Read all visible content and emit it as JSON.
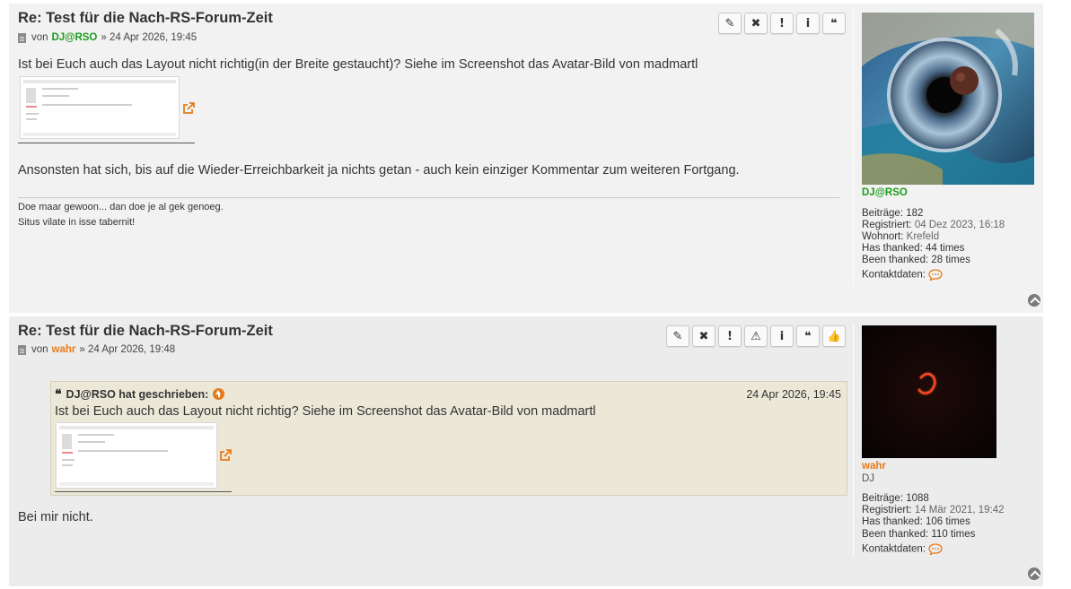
{
  "colors": {
    "accent_orange": "#e57c1c",
    "author_green": "#1e9b1e",
    "post1_bg": "#f2f2f2",
    "post2_bg": "#ececec",
    "quote_bg": "#ebe8d8"
  },
  "posts": [
    {
      "title": "Re: Test für die Nach-RS-Forum-Zeit",
      "meta_prefix": "von",
      "author": "DJ@RSO",
      "meta_suffix": "» 24 Apr 2026, 19:45",
      "buttons": [
        {
          "icon": "pencil-icon",
          "glyph": "✎"
        },
        {
          "icon": "delete-icon",
          "glyph": "✖"
        },
        {
          "icon": "report-icon",
          "glyph": "!"
        },
        {
          "icon": "info-icon",
          "glyph": "i"
        },
        {
          "icon": "quote-icon",
          "glyph": "❝"
        }
      ],
      "text1": "Ist bei Euch auch das Layout nicht richtig(in der Breite gestaucht)? Siehe im Screenshot das Avatar-Bild von madmartl",
      "text2": "Ansonsten hat sich, bis auf die Wieder-Erreichbarkeit ja nichts getan - auch kein einziger Kommentar zum weiteren Fortgang.",
      "signature": [
        "Doe maar gewoon... dan doe je al gek genoeg.",
        "Situs vilate in isse tabernit!"
      ],
      "profile": {
        "name": "DJ@RSO",
        "stats": [
          {
            "label": "Beiträge:",
            "value": "182"
          },
          {
            "label": "Registriert:",
            "value": "04 Dez 2023, 16:18"
          },
          {
            "label": "Wohnort:",
            "value": "Krefeld"
          },
          {
            "label": "Has thanked:",
            "value": "44 times"
          },
          {
            "label": "Been thanked:",
            "value": "28 times"
          }
        ],
        "contact_label": "Kontaktdaten:"
      }
    },
    {
      "title": "Re: Test für die Nach-RS-Forum-Zeit",
      "meta_prefix": "von",
      "author": "wahr",
      "meta_suffix": "» 24 Apr 2026, 19:48",
      "buttons": [
        {
          "icon": "pencil-icon",
          "glyph": "✎"
        },
        {
          "icon": "delete-icon",
          "glyph": "✖"
        },
        {
          "icon": "report-icon",
          "glyph": "!"
        },
        {
          "icon": "warning-icon",
          "glyph": "⚠"
        },
        {
          "icon": "info-icon",
          "glyph": "i"
        },
        {
          "icon": "quote-icon",
          "glyph": "❝"
        },
        {
          "icon": "thumbs-up-icon",
          "glyph": "👍"
        }
      ],
      "quote": {
        "author_line": "DJ@RSO hat geschrieben:",
        "date": "24 Apr 2026, 19:45",
        "text": "Ist bei Euch auch das Layout nicht richtig? Siehe im Screenshot das Avatar-Bild von madmartl"
      },
      "reply": "Bei mir nicht.",
      "profile": {
        "name": "wahr",
        "rank": "DJ",
        "stats": [
          {
            "label": "Beiträge:",
            "value": "1088"
          },
          {
            "label": "Registriert:",
            "value": "14 Mär 2021, 19:42"
          },
          {
            "label": "Has thanked:",
            "value": "106 times"
          },
          {
            "label": "Been thanked:",
            "value": "110 times"
          }
        ],
        "contact_label": "Kontaktdaten:"
      }
    }
  ]
}
